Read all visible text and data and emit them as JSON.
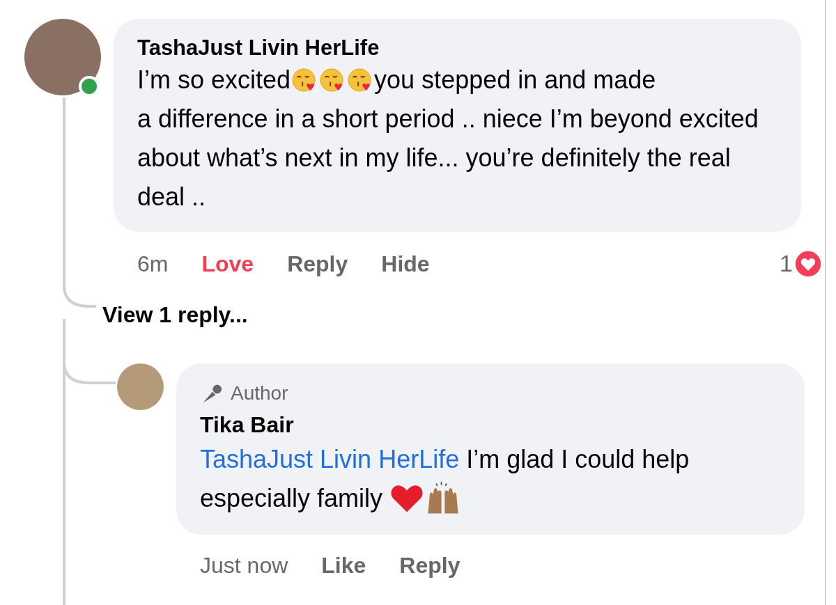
{
  "comment": {
    "author": "TashaJust Livin HerLife",
    "online": true,
    "text": [
      "I’m so excited",
      "you stepped in and made",
      "a difference in a short period .. niece I’m beyond excited about what’s next in my life... you’re definitely the real deal .."
    ],
    "time": "6m",
    "actions": [
      {
        "label": "Love",
        "selected": true
      },
      {
        "label": "Reply",
        "selected": false
      },
      {
        "label": "Hide",
        "selected": false
      }
    ],
    "reaction_count": "1"
  },
  "view_replies": "View 1 reply...",
  "reply": {
    "badge": "Author",
    "author": "Tika Bair",
    "mention": "TashaJust Livin HerLife",
    "text": [
      "I’m glad I could help",
      "especially family"
    ],
    "time": "Just now",
    "actions": [
      {
        "label": "Like",
        "selected": false
      },
      {
        "label": "Reply",
        "selected": false
      }
    ]
  }
}
